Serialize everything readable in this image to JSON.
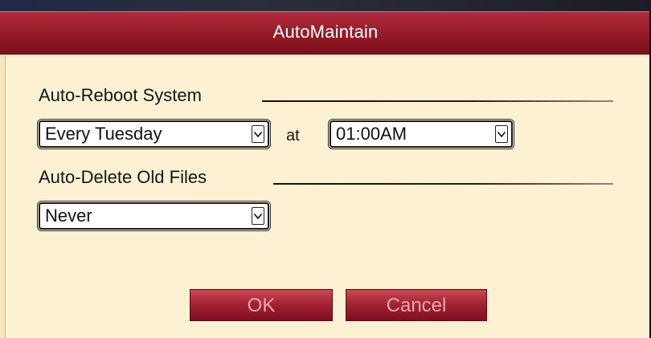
{
  "window": {
    "title": "AutoMaintain"
  },
  "auto_reboot": {
    "section_label": "Auto-Reboot System",
    "day_value": "Every Tuesday",
    "at_label": "at",
    "time_value": "01:00AM"
  },
  "auto_delete": {
    "section_label": "Auto-Delete Old Files",
    "value": "Never"
  },
  "buttons": {
    "ok_label": "OK",
    "cancel_label": "Cancel"
  },
  "colors": {
    "title_bar": "#991d2b",
    "background": "#fdf1d3",
    "button": "#a52434",
    "button_text": "#e9a7ae"
  },
  "icons": {
    "dropdown_arrow": "chevron-down-icon"
  }
}
